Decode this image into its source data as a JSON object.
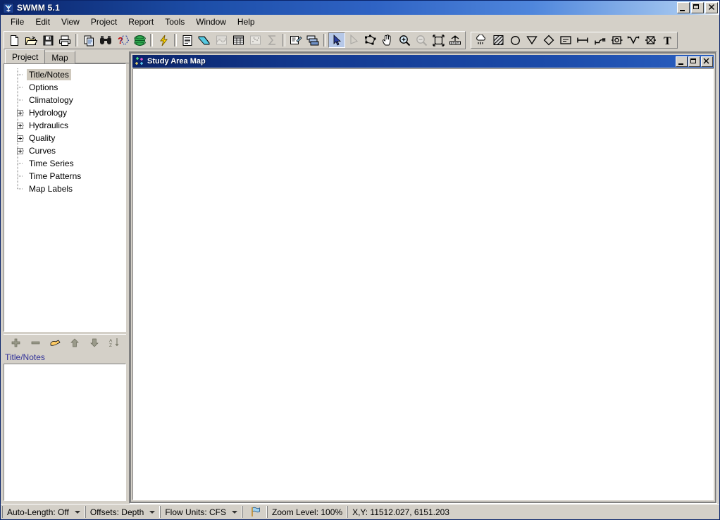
{
  "window": {
    "title": "SWMM 5.1",
    "icon": "swmm-logo-icon",
    "controls": {
      "minimize": "_",
      "maximize": "□",
      "close": "✕"
    }
  },
  "menubar": {
    "items": [
      {
        "label": "File"
      },
      {
        "label": "Edit"
      },
      {
        "label": "View"
      },
      {
        "label": "Project"
      },
      {
        "label": "Report"
      },
      {
        "label": "Tools"
      },
      {
        "label": "Window"
      },
      {
        "label": "Help"
      }
    ]
  },
  "toolbar_main": {
    "groups": [
      {
        "buttons": [
          {
            "name": "new-project-button",
            "icon": "new-file-icon",
            "title": "New Project"
          },
          {
            "name": "open-project-button",
            "icon": "open-folder-icon",
            "title": "Open Project"
          },
          {
            "name": "save-project-button",
            "icon": "floppy-disk-icon",
            "title": "Save Project"
          },
          {
            "name": "print-button",
            "icon": "printer-icon",
            "title": "Print"
          }
        ]
      },
      {
        "buttons": [
          {
            "name": "copy-button",
            "icon": "copy-pages-icon",
            "title": "Copy"
          },
          {
            "name": "find-button",
            "icon": "binoculars-icon",
            "title": "Find Object"
          },
          {
            "name": "query-button",
            "icon": "question-braces-icon",
            "title": "Query"
          },
          {
            "name": "overview-map-button",
            "icon": "globe-icon",
            "title": "Overview Map"
          }
        ]
      },
      {
        "buttons": [
          {
            "name": "run-simulation-button",
            "icon": "lightning-bolt-icon",
            "title": "Run Simulation"
          }
        ]
      },
      {
        "buttons": [
          {
            "name": "status-report-button",
            "icon": "report-page-icon",
            "title": "Status Report"
          },
          {
            "name": "profile-plot-button",
            "icon": "profile-plot-icon",
            "title": "Profile Plot"
          },
          {
            "name": "time-series-plot-button",
            "icon": "time-series-icon",
            "title": "Time Series Plot",
            "disabled": true
          },
          {
            "name": "table-button",
            "icon": "grid-table-icon",
            "title": "Table"
          },
          {
            "name": "scatter-plot-button",
            "icon": "scatter-plot-icon",
            "title": "Scatter Plot",
            "disabled": true
          },
          {
            "name": "statistics-button",
            "icon": "sigma-icon",
            "title": "Statistics",
            "disabled": true
          }
        ]
      },
      {
        "buttons": [
          {
            "name": "options-button",
            "icon": "properties-pen-icon",
            "title": "Options"
          },
          {
            "name": "arrange-windows-button",
            "icon": "window-tile-icon",
            "title": "Arrange Windows"
          }
        ]
      },
      {
        "buttons": [
          {
            "name": "select-object-tool",
            "icon": "arrow-pointer-icon",
            "title": "Select Object",
            "pressed": true
          },
          {
            "name": "select-vertex-tool",
            "icon": "vertex-arrow-icon",
            "title": "Select Vertex",
            "disabled": true
          },
          {
            "name": "select-region-tool",
            "icon": "select-region-icon",
            "title": "Select Region"
          },
          {
            "name": "pan-tool",
            "icon": "hand-pan-icon",
            "title": "Pan"
          },
          {
            "name": "zoom-in-tool",
            "icon": "magnifier-plus-icon",
            "title": "Zoom In"
          },
          {
            "name": "zoom-out-tool",
            "icon": "magnifier-minus-icon",
            "title": "Zoom Out",
            "disabled": true
          },
          {
            "name": "full-extent-tool",
            "icon": "full-extent-icon",
            "title": "Full Extent"
          },
          {
            "name": "map-dimensions-tool",
            "icon": "map-dimensions-icon",
            "title": "Map Dimensions"
          }
        ]
      }
    ]
  },
  "toolbar_objects": {
    "buttons": [
      {
        "name": "add-rain-gage-tool",
        "icon": "rain-gage-icon",
        "title": "Add Rain Gage"
      },
      {
        "name": "add-subcatchment-tool",
        "icon": "subcatchment-icon",
        "title": "Add Subcatchment"
      },
      {
        "name": "add-junction-tool",
        "icon": "junction-circle-icon",
        "title": "Add Junction Node"
      },
      {
        "name": "add-outfall-tool",
        "icon": "outfall-triangle-icon",
        "title": "Add Outfall Node"
      },
      {
        "name": "add-divider-tool",
        "icon": "divider-diamond-icon",
        "title": "Add Flow Divider"
      },
      {
        "name": "add-storage-tool",
        "icon": "storage-unit-icon",
        "title": "Add Storage Unit"
      },
      {
        "name": "add-conduit-tool",
        "icon": "conduit-line-icon",
        "title": "Add Conduit Link"
      },
      {
        "name": "add-pump-tool",
        "icon": "pump-icon",
        "title": "Add Pump Link"
      },
      {
        "name": "add-orifice-tool",
        "icon": "orifice-icon",
        "title": "Add Orifice Link"
      },
      {
        "name": "add-weir-tool",
        "icon": "weir-icon",
        "title": "Add Weir Link"
      },
      {
        "name": "add-outlet-tool",
        "icon": "outlet-icon",
        "title": "Add Outlet Link"
      },
      {
        "name": "add-label-tool",
        "icon": "text-label-icon",
        "title": "Add Label"
      }
    ]
  },
  "browser": {
    "tabs": [
      {
        "label": "Project",
        "active": true
      },
      {
        "label": "Map",
        "active": false
      }
    ],
    "tree": [
      {
        "label": "Title/Notes",
        "expandable": false,
        "selected": true
      },
      {
        "label": "Options",
        "expandable": false,
        "selected": false
      },
      {
        "label": "Climatology",
        "expandable": false,
        "selected": false
      },
      {
        "label": "Hydrology",
        "expandable": true,
        "selected": false
      },
      {
        "label": "Hydraulics",
        "expandable": true,
        "selected": false
      },
      {
        "label": "Quality",
        "expandable": true,
        "selected": false
      },
      {
        "label": "Curves",
        "expandable": true,
        "selected": false
      },
      {
        "label": "Time Series",
        "expandable": false,
        "selected": false
      },
      {
        "label": "Time Patterns",
        "expandable": false,
        "selected": false
      },
      {
        "label": "Map Labels",
        "expandable": false,
        "selected": false
      }
    ],
    "tree_toolbar": [
      {
        "name": "add-object-button",
        "icon": "plus-icon",
        "title": "Add Object"
      },
      {
        "name": "delete-object-button",
        "icon": "minus-icon",
        "title": "Delete Object"
      },
      {
        "name": "edit-object-button",
        "icon": "edit-hand-icon",
        "title": "Edit Object"
      },
      {
        "name": "move-up-button",
        "icon": "arrow-up-icon",
        "title": "Move Up"
      },
      {
        "name": "move-down-button",
        "icon": "arrow-down-icon",
        "title": "Move Down"
      },
      {
        "name": "sort-button",
        "icon": "sort-az-icon",
        "title": "Sort"
      }
    ],
    "editor_label": "Title/Notes",
    "editor_value": ""
  },
  "map_window": {
    "title": "Study Area Map",
    "icon": "study-area-map-icon",
    "controls": {
      "minimize": "_",
      "maximize": "□",
      "close": "✕"
    }
  },
  "statusbar": {
    "auto_length": "Auto-Length: Off",
    "offsets": "Offsets: Depth",
    "flow_units": "Flow Units: CFS",
    "run_status_icon": "run-status-flag-icon",
    "zoom_level": "Zoom Level: 100%",
    "coordinates": "X,Y: 11512.027, 6151.203"
  },
  "colors": {
    "titlebar_start": "#0a246a",
    "titlebar_end": "#a6c8f0",
    "face": "#d4d0c8",
    "accent_text": "#333399",
    "selection": "#cfc9bd"
  }
}
